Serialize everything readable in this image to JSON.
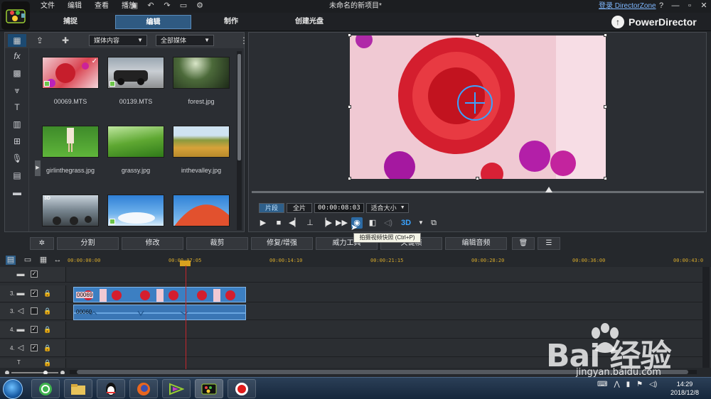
{
  "menu": {
    "items": [
      "文件",
      "编辑",
      "查看",
      "播放"
    ],
    "window_title": "未命名的新项目*",
    "director_zone": "登录 DirectorZone",
    "help": "?"
  },
  "modes": {
    "tabs": [
      "捕捉",
      "编辑",
      "制作",
      "创建光盘"
    ],
    "active": "编辑",
    "brand": "PowerDirector"
  },
  "library": {
    "dropdown_content": "媒体内容",
    "dropdown_filter": "全部媒体",
    "items": [
      {
        "name": "00069.MTS",
        "checked": true
      },
      {
        "name": "00139.MTS",
        "checked": false
      },
      {
        "name": "forest.jpg",
        "checked": false
      },
      {
        "name": "girlinthegrass.jpg",
        "checked": false
      },
      {
        "name": "grassy.jpg",
        "checked": false
      },
      {
        "name": "inthevalley.jpg",
        "checked": false
      },
      {
        "name": "3D",
        "checked": false
      },
      {
        "name": "",
        "checked": false
      },
      {
        "name": "",
        "checked": false
      }
    ]
  },
  "preview": {
    "seg_clip": "片段",
    "seg_movie": "全片",
    "timecode": "00:00:08:03",
    "fit": "适合大小",
    "mode3d": "3D",
    "tooltip": "拍摄视频快照 (Ctrl+P)"
  },
  "editbar": {
    "buttons": [
      "分割",
      "修改",
      "裁剪",
      "修复/增强",
      "威力工具",
      "关键帧",
      "编辑音频"
    ]
  },
  "timeline": {
    "ticks": [
      "00:00:00:00",
      "00:00:07:05",
      "00:00:14:10",
      "00:00:21:15",
      "00:00:28:20",
      "00:00:36:00",
      "00:00:43:0"
    ],
    "tracks": [
      {
        "label": "",
        "checked": true
      },
      {
        "label": "3.",
        "checked": true
      },
      {
        "label": "3.",
        "checked": false
      },
      {
        "label": "4.",
        "checked": true
      },
      {
        "label": "4.",
        "checked": true
      },
      {
        "label": "T",
        "checked": false
      }
    ],
    "clip_video": "00069",
    "clip_audio": "00069"
  },
  "taskbar": {
    "time": "14:29",
    "date": "2018/12/8"
  },
  "watermark": {
    "text": "Bai 经验",
    "url": "jingyan.baidu.com"
  },
  "colors": {
    "accent": "#2f5a82",
    "clip": "#3c7fc2",
    "playhead": "#c4262b",
    "ruler": "#d4a82c"
  }
}
